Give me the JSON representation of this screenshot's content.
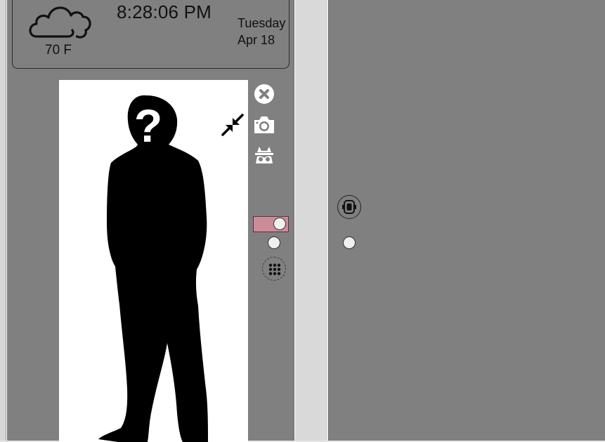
{
  "header": {
    "weather": {
      "icon": "cloud-icon",
      "temperature": "70 F"
    },
    "clock": {
      "time": "8:28:06 PM",
      "day": "Tuesday",
      "date": "Apr 18"
    }
  },
  "video": {
    "placeholder": "unknown-person-silhouette"
  },
  "controls": {
    "close": {
      "icon": "close-icon"
    },
    "camera": {
      "icon": "camera-icon"
    },
    "incognito": {
      "icon": "incognito-icon"
    },
    "collapse": {
      "icon": "collapse-arrows-icon"
    },
    "toggle": {
      "state": "on",
      "color": "#c98d99"
    },
    "dialpad": {
      "icon": "dialpad-icon"
    }
  },
  "right_panel": {
    "camera_switch": {
      "icon": "camera-switch-icon"
    }
  },
  "colors": {
    "panel_bg": "#808080",
    "divider": "#d9d9d9",
    "frame_bg": "#ffffff",
    "toggle_on": "#c98d99"
  }
}
